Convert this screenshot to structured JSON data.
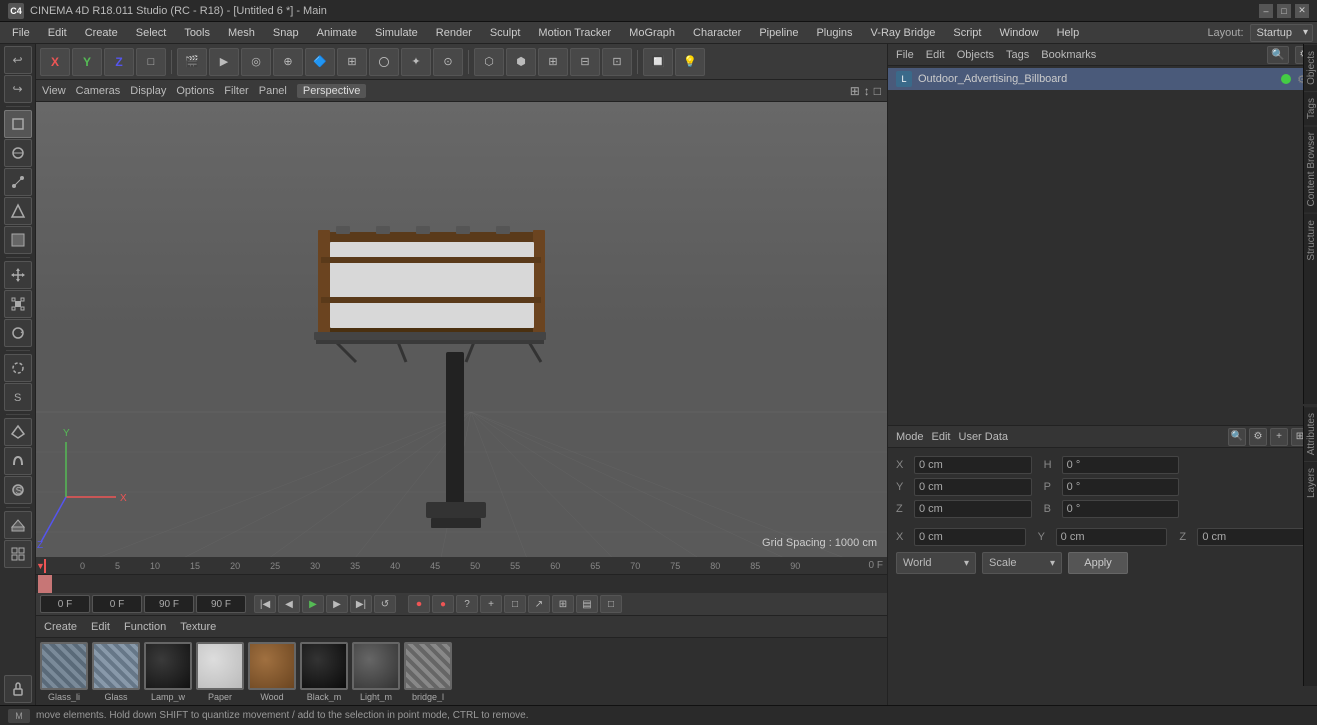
{
  "titleBar": {
    "icon": "C4D",
    "title": "CINEMA 4D R18.011 Studio (RC - R18) - [Untitled 6 *] - Main",
    "minimize": "–",
    "maximize": "□",
    "close": "✕"
  },
  "menuBar": {
    "items": [
      "File",
      "Edit",
      "Create",
      "Select",
      "Tools",
      "Mesh",
      "Snap",
      "Animate",
      "Simulate",
      "Render",
      "Sculpt",
      "Motion Tracker",
      "MoGraph",
      "Character",
      "Pipeline",
      "Plugins",
      "V-Ray Bridge",
      "Script",
      "Window",
      "Help"
    ]
  },
  "layout": {
    "label": "Layout:",
    "value": "Startup"
  },
  "toolbar": {
    "undoBtn": "↩",
    "redoBtn": "↪",
    "tools": [
      "↖",
      "✛",
      "⬜",
      "↻",
      "✛",
      "X",
      "Y",
      "Z",
      "□",
      "🎬",
      "►",
      "◎",
      "🔷",
      "🔶",
      "〇",
      "⊕",
      "⊙",
      "⊞",
      "💡"
    ],
    "cameraIcon": "📷",
    "renderIcon": "🎬"
  },
  "viewport": {
    "menus": [
      "View",
      "Cameras",
      "Display",
      "Options",
      "Filter",
      "Panel"
    ],
    "label": "Perspective",
    "gridSpacing": "Grid Spacing : 1000 cm"
  },
  "timeline": {
    "startFrame": "0 F",
    "currentFrame": "0 F",
    "endFrame": "90 F",
    "endFrame2": "90 F",
    "ticks": [
      "0",
      "5",
      "10",
      "15",
      "20",
      "25",
      "30",
      "35",
      "40",
      "45",
      "50",
      "55",
      "60",
      "65",
      "70",
      "75",
      "80",
      "85",
      "90"
    ],
    "frameIndicator": "0 F"
  },
  "rightPanel": {
    "topTabs": [
      "File",
      "Edit",
      "Objects",
      "Tags",
      "Bookmarks"
    ],
    "searchIcon": "🔍",
    "settingsIcon": "⚙",
    "objectName": "Outdoor_Advertising_Billboard",
    "objectIcon": "L",
    "greenDot": true
  },
  "attrPanel": {
    "tabs": [
      "Mode",
      "Edit",
      "User Data"
    ],
    "searchIcons": [
      "🔍",
      "⚙",
      "⊕",
      "⊞"
    ],
    "fields": {
      "x_label": "X",
      "x_pos": "0 cm",
      "h_label": "H",
      "h_val": "0 °",
      "y_label": "Y",
      "y_pos": "0 cm",
      "p_label": "P",
      "p_val": "0 °",
      "z_label": "Z",
      "z_pos": "0 cm",
      "b_label": "B",
      "b_val": "0 °"
    },
    "coordX2": "0 cm",
    "coordY2": "0 cm",
    "coordZ2": "0 cm",
    "worldDropdown": "World",
    "scaleDropdown": "Scale",
    "applyBtn": "Apply"
  },
  "materials": {
    "toolbar": [
      "Create",
      "Edit",
      "Function",
      "Texture"
    ],
    "items": [
      {
        "name": "Glass_li",
        "color": "#7a8a99"
      },
      {
        "name": "Glass",
        "color": "#8899aa"
      },
      {
        "name": "Lamp_w",
        "color": "#2a2a2a"
      },
      {
        "name": "Paper",
        "color": "#cccccc"
      },
      {
        "name": "Wood",
        "color": "#8b5e3c"
      },
      {
        "name": "Black_m",
        "color": "#1a1a1a"
      },
      {
        "name": "Light_m",
        "color": "#555555"
      },
      {
        "name": "bridge_l",
        "color": "#888888"
      }
    ]
  },
  "statusBar": {
    "message": "move elements. Hold down SHIFT to quantize movement / add to the selection in point mode, CTRL to remove."
  },
  "vtabs": [
    "Objects",
    "Tags",
    "Content Browser",
    "Structure",
    "Attributes",
    "Layers"
  ],
  "playbackButtons": [
    "⏮",
    "◀",
    "▶",
    "▶▶",
    "⏭",
    "↺"
  ],
  "recordButtons": [
    "⏺",
    "🔴",
    "❓",
    "✛",
    "□",
    "↻",
    "💾",
    "⊞",
    "□"
  ]
}
